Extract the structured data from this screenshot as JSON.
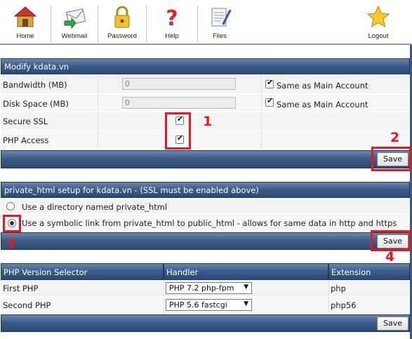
{
  "toolbar": {
    "items": [
      {
        "label": "Home",
        "icon": "home-icon"
      },
      {
        "label": "Webmail",
        "icon": "webmail-icon"
      },
      {
        "label": "Password",
        "icon": "lock-icon"
      },
      {
        "label": "Help",
        "icon": "help-icon"
      },
      {
        "label": "Files",
        "icon": "files-icon"
      },
      {
        "label": "Logout",
        "icon": "star-icon"
      }
    ]
  },
  "modify": {
    "title": "Modify kdata.vn",
    "bandwidth_label": "Bandwidth (MB)",
    "bandwidth_value": "0",
    "bandwidth_same_label": "Same as Main Account",
    "bandwidth_same_checked": true,
    "diskspace_label": "Disk Space (MB)",
    "diskspace_value": "0",
    "diskspace_same_label": "Same as Main Account",
    "diskspace_same_checked": true,
    "ssl_label": "Secure SSL",
    "ssl_checked": true,
    "php_label": "PHP Access",
    "php_checked": true,
    "save_label": "Save"
  },
  "private_html": {
    "title": "private_html setup for kdata.vn - (SSL must be enabled above)",
    "option_directory": "Use a directory named private_html",
    "option_symlink": "Use a symbolic link from private_html to public_html - allows for same data in http and https",
    "selected": "symlink",
    "save_label": "Save"
  },
  "php_selector": {
    "headers": [
      "PHP Version Selector",
      "Handler",
      "Extension"
    ],
    "rows": [
      {
        "name": "First PHP",
        "handler": "PHP 7.2 php-fpm",
        "extension": "php"
      },
      {
        "name": "Second PHP",
        "handler": "PHP 5.6 fastcgi",
        "extension": "php56"
      }
    ],
    "save_label": "Save"
  },
  "annotations": [
    "1",
    "2",
    "3",
    "4"
  ],
  "colors": {
    "accent_red": "#e01b22",
    "bar_navy": "#2b4a76"
  }
}
